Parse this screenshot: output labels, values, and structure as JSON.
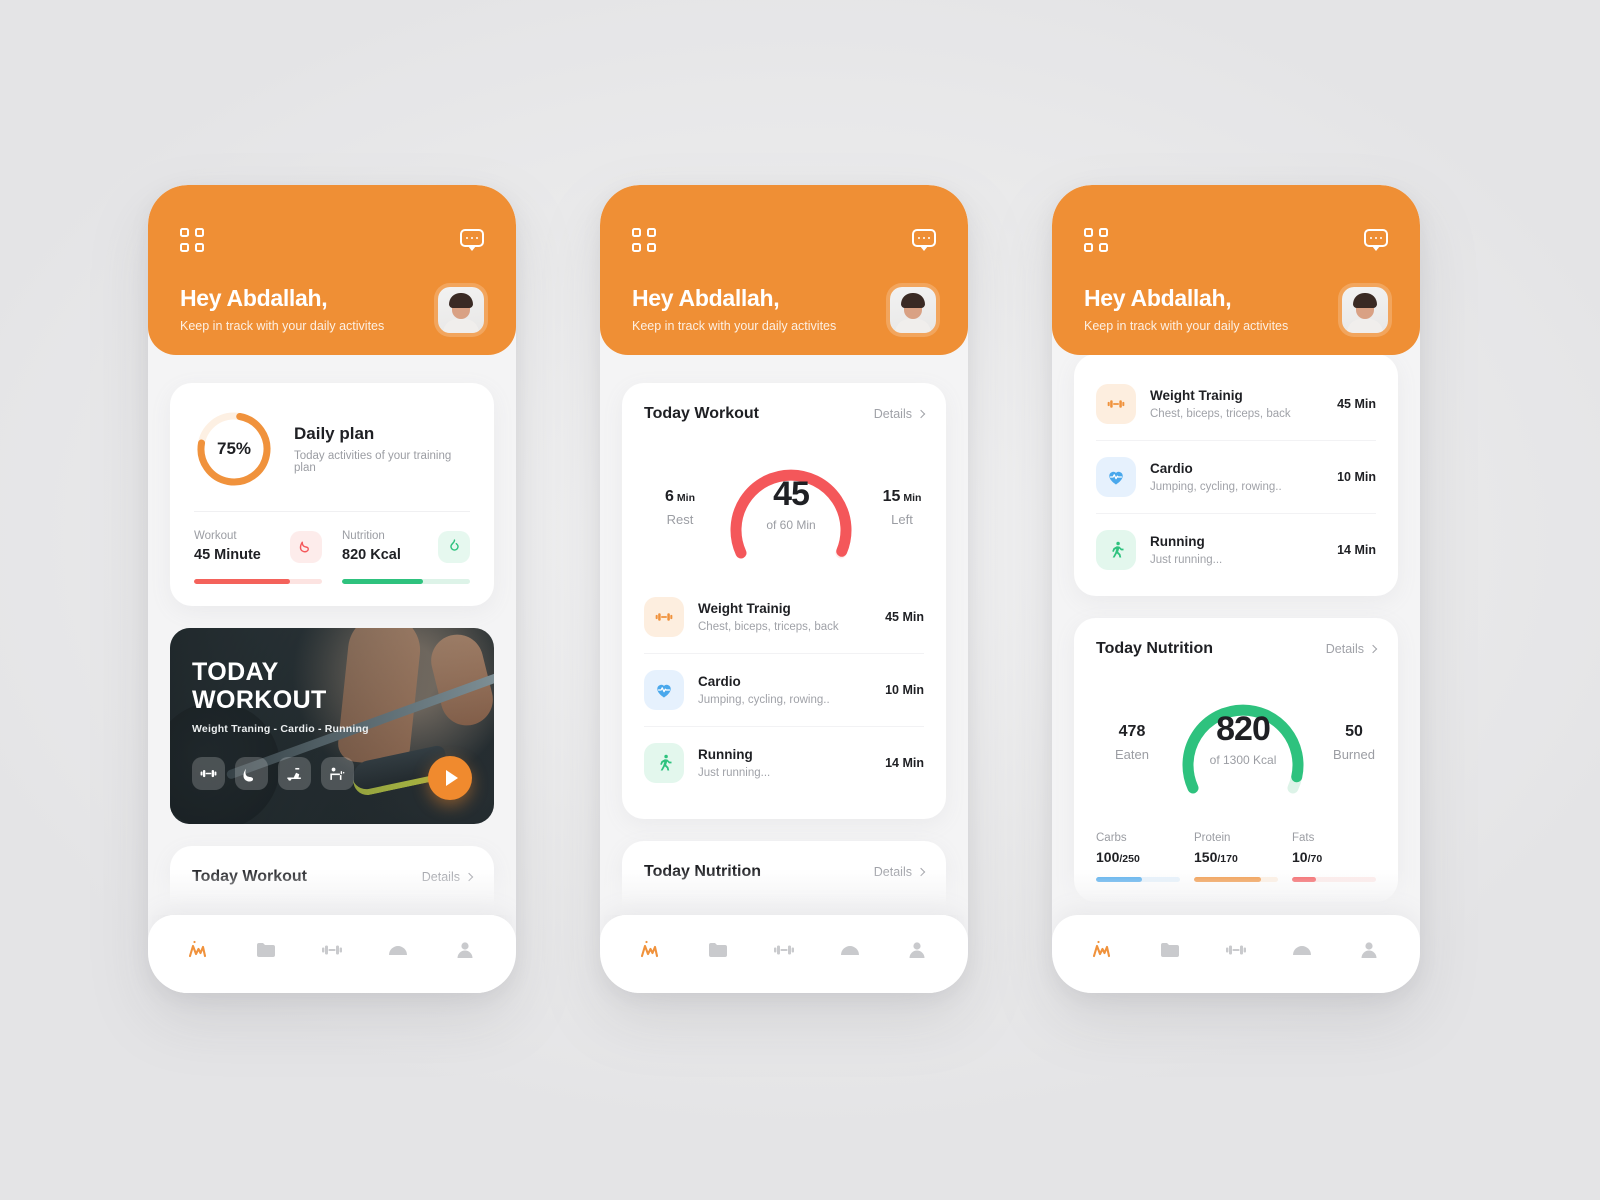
{
  "theme": {
    "orange": "#ef8f35",
    "red": "#f4575a",
    "green": "#2ec27e",
    "blue": "#4aa8ec",
    "dark": "#1f2024",
    "muted": "#9b9da3"
  },
  "header": {
    "greeting": "Hey Abdallah,",
    "subtitle": "Keep in track with your daily activites",
    "grid_icon": "grid-icon",
    "chat_icon": "chat-bubble-icon",
    "avatar_alt": "user-avatar"
  },
  "daily_plan": {
    "percent_label": "75%",
    "percent_value": 75,
    "title": "Daily plan",
    "subtitle": "Today activities of your training plan",
    "stats": [
      {
        "label": "Workout",
        "value": "45 Minute",
        "icon": "bicep-icon",
        "fill": 75,
        "color": "#f4625b"
      },
      {
        "label": "Nutrition",
        "value": "820 Kcal",
        "icon": "flame-icon",
        "fill": 63,
        "color": "#2ec27e"
      }
    ]
  },
  "banner": {
    "title_line1": "TODAY",
    "title_line2": "WORKOUT",
    "subtitle": "Weight Traning - Cardio - Running",
    "icons": [
      "dumbbell-icon",
      "bicep-icon",
      "exercise-bike-icon",
      "bench-press-icon"
    ],
    "play_label": "play-button"
  },
  "today_workout": {
    "title": "Today Workout",
    "details_label": "Details",
    "gauge": {
      "value": "45",
      "of_label": "of 60 Min",
      "total": 60,
      "done": 45,
      "left": {
        "num": "15",
        "unit": "Min",
        "label": "Left"
      },
      "rest": {
        "num": "6",
        "unit": "Min",
        "label": "Rest"
      }
    },
    "exercises": [
      {
        "name": "Weight Trainig",
        "desc": "Chest, biceps, triceps, back",
        "duration": "45 Min",
        "icon": "dumbbell-icon",
        "tone": "orange"
      },
      {
        "name": "Cardio",
        "desc": "Jumping, cycling, rowing..",
        "duration": "10 Min",
        "icon": "heartbeat-icon",
        "tone": "blue"
      },
      {
        "name": "Running",
        "desc": "Just running...",
        "duration": "14 Min",
        "icon": "running-icon",
        "tone": "green"
      }
    ]
  },
  "today_nutrition": {
    "title": "Today Nutrition",
    "details_label": "Details",
    "gauge": {
      "value": "820",
      "of_label": "of 1300 Kcal",
      "total": 1300,
      "done": 820,
      "eaten": {
        "num": "478",
        "label": "Eaten"
      },
      "burned": {
        "num": "50",
        "label": "Burned"
      }
    },
    "macros": [
      {
        "label": "Carbs",
        "value": "100",
        "denom": "/250",
        "fill": 55,
        "tone": "blue"
      },
      {
        "label": "Protein",
        "value": "150",
        "denom": "/170",
        "fill": 80,
        "tone": "orange"
      },
      {
        "label": "Fats",
        "value": "10",
        "denom": "/70",
        "fill": 28,
        "tone": "red"
      }
    ]
  },
  "tabbar": {
    "items": [
      {
        "icon": "activity-pulse-icon",
        "active": true
      },
      {
        "icon": "folder-icon",
        "active": false
      },
      {
        "icon": "dumbbell-icon",
        "active": false
      },
      {
        "icon": "food-dome-icon",
        "active": false
      },
      {
        "icon": "person-icon",
        "active": false
      }
    ]
  }
}
